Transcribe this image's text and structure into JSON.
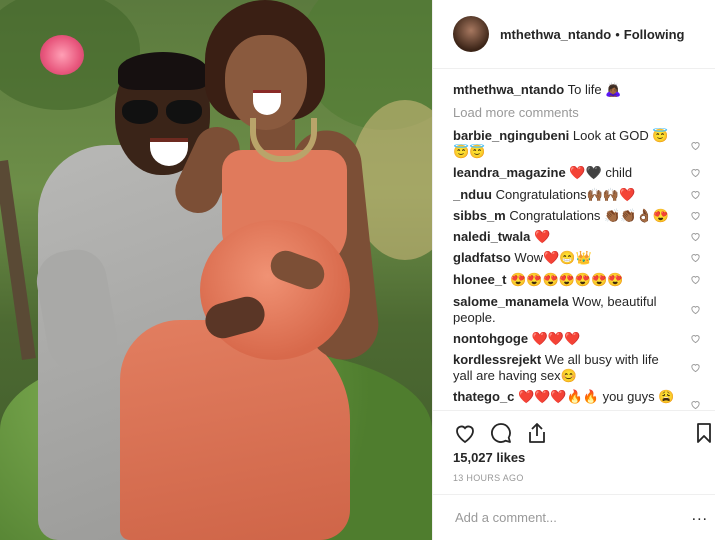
{
  "post": {
    "username": "mthethwa_ntando",
    "follow_status": "Following",
    "caption_user": "mthethwa_ntando",
    "caption_text": "To life 🙇🏾‍♀️",
    "load_more": "Load more comments",
    "likes": "15,027 likes",
    "timestamp": "13 HOURS AGO",
    "comment_placeholder": "Add a comment...",
    "more_label": "..."
  },
  "comments": [
    {
      "user": "barbie_ngingubeni",
      "text": "Look at GOD 😇😇😇"
    },
    {
      "user": "leandra_magazine",
      "text": "❤️🖤 child"
    },
    {
      "user": "_nduu",
      "text": "Congratulations🙌🏾🙌🏾❤️"
    },
    {
      "user": "sibbs_m",
      "text": "Congratulations 👏🏾👏🏾👌🏾😍"
    },
    {
      "user": "naledi_twala",
      "text": "❤️"
    },
    {
      "user": "gladfatso",
      "text": "Wow❤️😁👑"
    },
    {
      "user": "hlonee_t",
      "text": "😍😍😍😍😍😍😍"
    },
    {
      "user": "salome_manamela",
      "text": "Wow, beautiful people."
    },
    {
      "user": "nontohgoge",
      "text": "❤️❤️❤️"
    },
    {
      "user": "kordlessrejekt",
      "text": "We all busy with life yall are having sex😊"
    },
    {
      "user": "thatego_c",
      "text": "❤️❤️❤️🔥🔥 you guys 😩"
    }
  ],
  "icons": {
    "like": "heart-icon",
    "comment": "comment-icon",
    "share": "share-icon",
    "save": "bookmark-icon"
  }
}
